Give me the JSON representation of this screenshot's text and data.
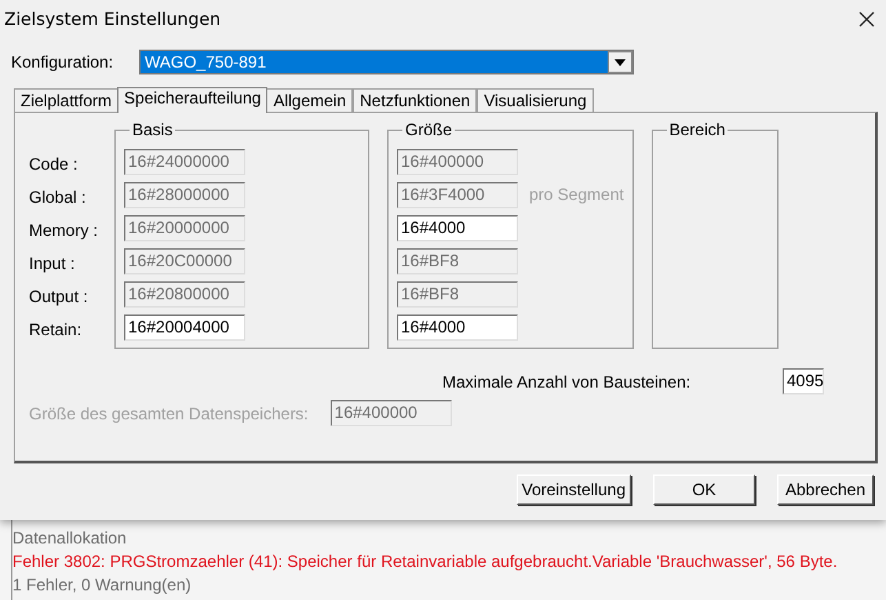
{
  "window": {
    "title": "Zielsystem Einstellungen"
  },
  "configuration": {
    "label": "Konfiguration:",
    "value": "WAGO_750-891"
  },
  "tabs": [
    {
      "label": "Zielplattform",
      "selected": false
    },
    {
      "label": "Speicheraufteilung",
      "selected": true
    },
    {
      "label": "Allgemein",
      "selected": false
    },
    {
      "label": "Netzfunktionen",
      "selected": false
    },
    {
      "label": "Visualisierung",
      "selected": false
    }
  ],
  "groups": {
    "basis": "Basis",
    "groesse": "Größe",
    "bereich": "Bereich"
  },
  "memory_rows": [
    {
      "label": "Code :",
      "basis": {
        "value": "16#24000000",
        "disabled": true
      },
      "groesse": {
        "value": "16#400000",
        "disabled": true
      }
    },
    {
      "label": "Global :",
      "basis": {
        "value": "16#28000000",
        "disabled": true
      },
      "groesse": {
        "value": "16#3F4000",
        "disabled": true
      },
      "note": "pro Segment"
    },
    {
      "label": "Memory :",
      "basis": {
        "value": "16#20000000",
        "disabled": true
      },
      "groesse": {
        "value": "16#4000",
        "disabled": false
      }
    },
    {
      "label": "Input :",
      "basis": {
        "value": "16#20C00000",
        "disabled": true
      },
      "groesse": {
        "value": "16#BF8",
        "disabled": true
      }
    },
    {
      "label": "Output :",
      "basis": {
        "value": "16#20800000",
        "disabled": true
      },
      "groesse": {
        "value": "16#BF8",
        "disabled": true
      }
    },
    {
      "label": "Retain:",
      "basis": {
        "value": "16#20004000",
        "disabled": false
      },
      "groesse": {
        "value": "16#4000",
        "disabled": false
      }
    }
  ],
  "max_blocks": {
    "label": "Maximale Anzahl von Bausteinen:",
    "value": "4095",
    "disabled": false
  },
  "total_data_memory": {
    "label": "Größe des gesamten Datenspeichers:",
    "value": "16#400000",
    "disabled": true
  },
  "buttons": [
    "Voreinstellung",
    "OK",
    "Abbrechen"
  ],
  "messages": [
    {
      "text": "Datenallokation",
      "kind": "info"
    },
    {
      "text": "Fehler 3802: PRGStromzaehler (41): Speicher für Retainvariable aufgebraucht.Variable 'Brauchwasser', 56 Byte.",
      "kind": "error"
    },
    {
      "text": "1 Fehler, 0 Warnung(en)",
      "kind": "info"
    }
  ]
}
